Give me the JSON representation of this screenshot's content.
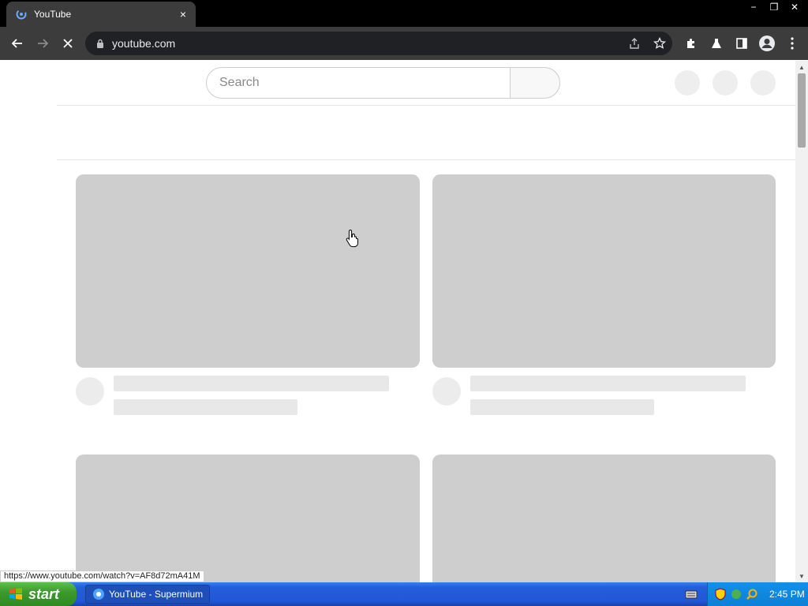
{
  "browser": {
    "tab_title": "YouTube",
    "tab_close": "×",
    "url": "youtube.com",
    "window_controls": {
      "minimize": "−",
      "restore": "❐",
      "close": "✕"
    }
  },
  "youtube": {
    "search_placeholder": "Search"
  },
  "status_url": "https://www.youtube.com/watch?v=AF8d72mA41M",
  "taskbar": {
    "start_label": "start",
    "task_item": "YouTube - Supermium",
    "clock": "2:45 PM"
  },
  "colors": {
    "chrome_dark": "#3c3c3c",
    "skeleton": "#cecece",
    "taskbar_blue": "#245edb",
    "start_green": "#3c9a2c"
  }
}
